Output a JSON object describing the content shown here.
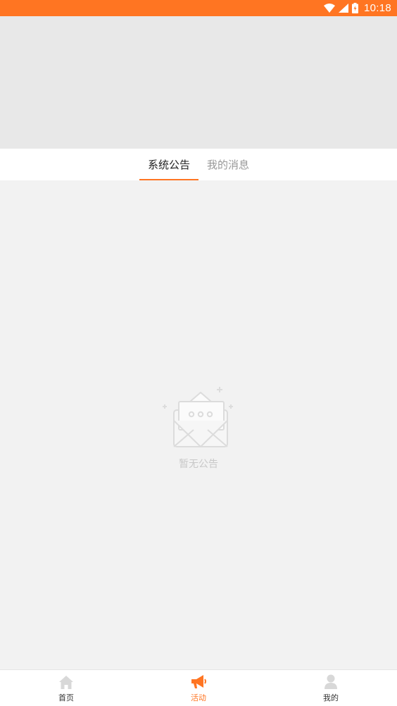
{
  "status_bar": {
    "time": "10:18",
    "background_color": "#ff7522",
    "icons": [
      "wifi-icon",
      "signal-icon",
      "battery-icon"
    ]
  },
  "tabs": [
    {
      "label": "系统公告",
      "active": true
    },
    {
      "label": "我的消息",
      "active": false
    }
  ],
  "empty_state": {
    "icon": "envelope-icon",
    "text": "暂无公告"
  },
  "bottom_nav": [
    {
      "label": "首页",
      "icon": "home-icon",
      "active": false
    },
    {
      "label": "活动",
      "icon": "megaphone-icon",
      "active": true
    },
    {
      "label": "我的",
      "icon": "user-icon",
      "active": false
    }
  ],
  "colors": {
    "accent": "#ff7522",
    "inactive_icon": "#d8d8d8"
  }
}
